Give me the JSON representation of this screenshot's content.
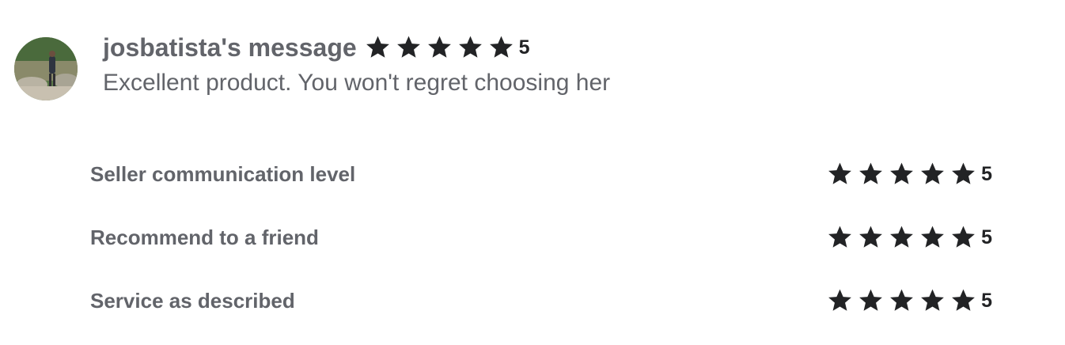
{
  "review": {
    "author_label": "josbatista's message",
    "rating": 5,
    "rating_text": "5",
    "message": "Excellent product. You won't regret choosing her"
  },
  "criteria": [
    {
      "label": "Seller communication level",
      "rating": 5,
      "rating_text": "5"
    },
    {
      "label": "Recommend to a friend",
      "rating": 5,
      "rating_text": "5"
    },
    {
      "label": "Service as described",
      "rating": 5,
      "rating_text": "5"
    }
  ],
  "colors": {
    "star": "#222325",
    "muted_text": "#62646a"
  },
  "icons": {
    "star": "star-icon",
    "avatar": "user-avatar-photo"
  }
}
